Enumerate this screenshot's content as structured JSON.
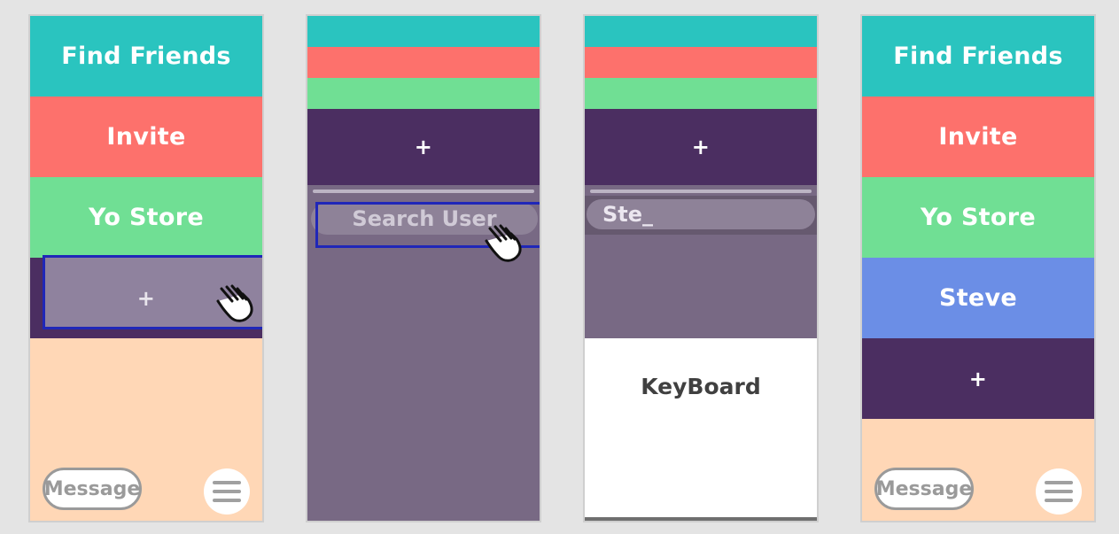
{
  "colors": {
    "teal": "#2ac4bf",
    "coral": "#fd716c",
    "green": "#70df94",
    "purple": "#4b2e61",
    "blue": "#6b8ee6",
    "peach": "#ffd7b6",
    "overlay": "#786984",
    "highlight": "#2027b8"
  },
  "screen1": {
    "find_friends": "Find Friends",
    "invite": "Invite",
    "yo_store": "Yo Store",
    "add": "+",
    "message": "Message",
    "menu_icon": "hamburger-menu-icon",
    "cursor_icon": "hand-pointer-icon"
  },
  "screen2": {
    "add": "+",
    "search_placeholder": "Search User",
    "cursor_icon": "hand-pointer-icon"
  },
  "screen3": {
    "add": "+",
    "search_value": "Ste_",
    "keyboard": "KeyBoard"
  },
  "screen4": {
    "find_friends": "Find Friends",
    "invite": "Invite",
    "yo_store": "Yo Store",
    "steve": "Steve",
    "add": "+",
    "message": "Message",
    "menu_icon": "hamburger-menu-icon"
  }
}
